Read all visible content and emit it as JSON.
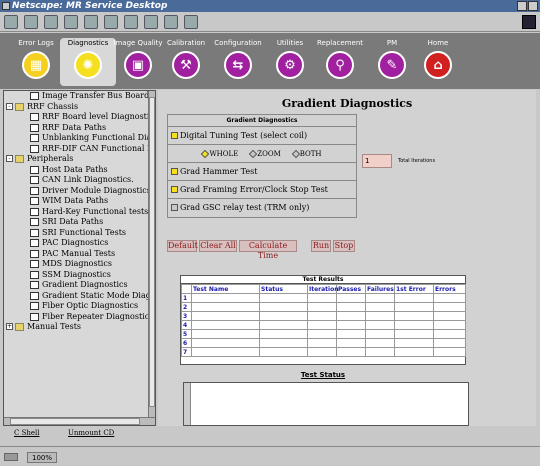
{
  "window": {
    "title": "Netscape: MR Service Desktop"
  },
  "nav": [
    {
      "label": "Error Logs",
      "icon": "grid-icon",
      "color": "#f5d020",
      "active": false,
      "glyph": "▦"
    },
    {
      "label": "Diagnostics",
      "icon": "diagnostics-icon",
      "color": "#f5e020",
      "active": true,
      "glyph": "✺"
    },
    {
      "label": "Image Quality",
      "icon": "image-quality-icon",
      "color": "#a020a0",
      "active": false,
      "glyph": "▣"
    },
    {
      "label": "Calibration",
      "icon": "calibration-icon",
      "color": "#a020a0",
      "active": false,
      "glyph": "⚒"
    },
    {
      "label": "Configuration",
      "icon": "configuration-icon",
      "color": "#a020a0",
      "active": false,
      "glyph": "⇆"
    },
    {
      "label": "Utilities",
      "icon": "utilities-icon",
      "color": "#a020a0",
      "active": false,
      "glyph": "⚙"
    },
    {
      "label": "Replacement",
      "icon": "replacement-icon",
      "color": "#a020a0",
      "active": false,
      "glyph": "⚲"
    },
    {
      "label": "PM",
      "icon": "pm-icon",
      "color": "#a020a0",
      "active": false,
      "glyph": "✎"
    },
    {
      "label": "Home",
      "icon": "home-icon",
      "color": "#d02020",
      "active": false,
      "glyph": "⌂"
    }
  ],
  "tree": [
    {
      "label": "Image Transfer Bus Board Leve",
      "depth": 2,
      "type": "doc"
    },
    {
      "label": "RRF Chassis",
      "depth": 1,
      "type": "folder",
      "toggle": "-"
    },
    {
      "label": "RRF Board level Diagnostics",
      "depth": 2,
      "type": "doc"
    },
    {
      "label": "RRF Data Paths",
      "depth": 2,
      "type": "doc"
    },
    {
      "label": "Unblanking Functional Diagnos",
      "depth": 2,
      "type": "doc"
    },
    {
      "label": "RRF-DIF CAN Functional Dia",
      "depth": 2,
      "type": "doc"
    },
    {
      "label": "Peripherals",
      "depth": 1,
      "type": "folder",
      "toggle": "-"
    },
    {
      "label": "Host Data Paths",
      "depth": 2,
      "type": "doc"
    },
    {
      "label": "CAN Link Diagnostics.",
      "depth": 2,
      "type": "doc"
    },
    {
      "label": "Driver Module Diagnostics.",
      "depth": 2,
      "type": "doc"
    },
    {
      "label": "WIM Data Paths",
      "depth": 2,
      "type": "doc"
    },
    {
      "label": "Hard-Key Functional tests",
      "depth": 2,
      "type": "doc"
    },
    {
      "label": "SRI Data Paths",
      "depth": 2,
      "type": "doc"
    },
    {
      "label": "SRI Functional Tests",
      "depth": 2,
      "type": "doc"
    },
    {
      "label": "PAC Diagnostics",
      "depth": 2,
      "type": "doc"
    },
    {
      "label": "PAC Manual Tests",
      "depth": 2,
      "type": "doc"
    },
    {
      "label": "MDS Diagnostics",
      "depth": 2,
      "type": "doc"
    },
    {
      "label": "SSM Diagnostics",
      "depth": 2,
      "type": "doc"
    },
    {
      "label": "Gradient Diagnostics",
      "depth": 2,
      "type": "doc"
    },
    {
      "label": "Gradient Static Mode Diagnosti",
      "depth": 2,
      "type": "doc"
    },
    {
      "label": "Fiber Optic Diagnostics",
      "depth": 2,
      "type": "doc"
    },
    {
      "label": "Fiber Repeater Diagnostics",
      "depth": 2,
      "type": "doc"
    },
    {
      "label": "Manual Tests",
      "depth": 0,
      "type": "folder",
      "toggle": "+"
    }
  ],
  "main": {
    "title": "Gradient Diagnostics",
    "panel_heading": "Gradient Diagnostics",
    "tests": {
      "digital_tuning": "Digital Tuning Test (select coil)",
      "coil_whole": "WHOLE",
      "coil_zoom": "ZOOM",
      "coil_both": "BOTH",
      "grad_hammer": "Grad Hammer Test",
      "grad_framing": "Grad Framing Error/Clock Stop Test",
      "grad_gsc": "Grad GSC relay test (TRM only)"
    },
    "iterations_value": "1",
    "iterations_label": "Total Iterations",
    "buttons": {
      "default": "Default",
      "clear_all": "Clear All",
      "calc_time": "Calculate Time",
      "run": "Run",
      "stop": "Stop"
    },
    "results": {
      "title": "Test Results",
      "columns": [
        "",
        "Test Name",
        "Status",
        "Iteration",
        "Passes",
        "Failures",
        "1st Error",
        "Errors"
      ],
      "rows": [
        "1",
        "2",
        "3",
        "4",
        "5",
        "6",
        "7"
      ]
    },
    "status_title": "Test Status"
  },
  "bottom_tabs": {
    "cshell": "C Shell",
    "unmount": "Unmount CD"
  },
  "statusbar": {
    "zoom": "100%"
  }
}
